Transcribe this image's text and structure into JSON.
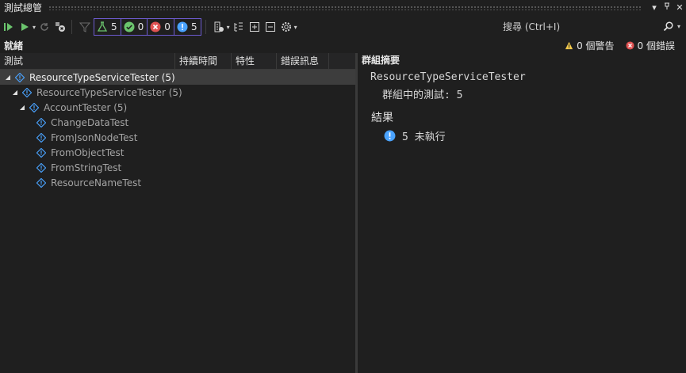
{
  "window": {
    "title": "測試總管"
  },
  "toolbar": {
    "counters": [
      {
        "icon": "flask-icon",
        "value": "5"
      },
      {
        "icon": "passed-icon",
        "value": "0"
      },
      {
        "icon": "failed-icon",
        "value": "0"
      },
      {
        "icon": "not-run-icon",
        "value": "5"
      }
    ],
    "search_placeholder": "搜尋 (Ctrl+I)"
  },
  "status": {
    "state": "就緒",
    "warnings": "0 個警告",
    "errors": "0 個錯誤"
  },
  "grid": {
    "columns": [
      "測試",
      "持續時間",
      "特性",
      "錯誤訊息"
    ],
    "rows": [
      {
        "label": "ResourceTypeServiceTester (5)"
      },
      {
        "label": "ResourceTypeServiceTester (5)"
      },
      {
        "label": "AccountTester (5)"
      },
      {
        "label": "ChangeDataTest"
      },
      {
        "label": "FromJsonNodeTest"
      },
      {
        "label": "FromObjectTest"
      },
      {
        "label": "FromStringTest"
      },
      {
        "label": "ResourceNameTest"
      }
    ]
  },
  "summary": {
    "header": "群組摘要",
    "group_name": "ResourceTypeServiceTester",
    "tests_in_group": "群組中的測試: 5",
    "results_label": "結果",
    "not_run": "5 未執行"
  },
  "colors": {
    "background": "#1f1f1f",
    "accent_border": "#6d5bd0",
    "not_run_blue": "#4aa3ff",
    "passed_green": "#6bc46d",
    "failed_red": "#e05252",
    "warning_yellow": "#f2c94c"
  }
}
